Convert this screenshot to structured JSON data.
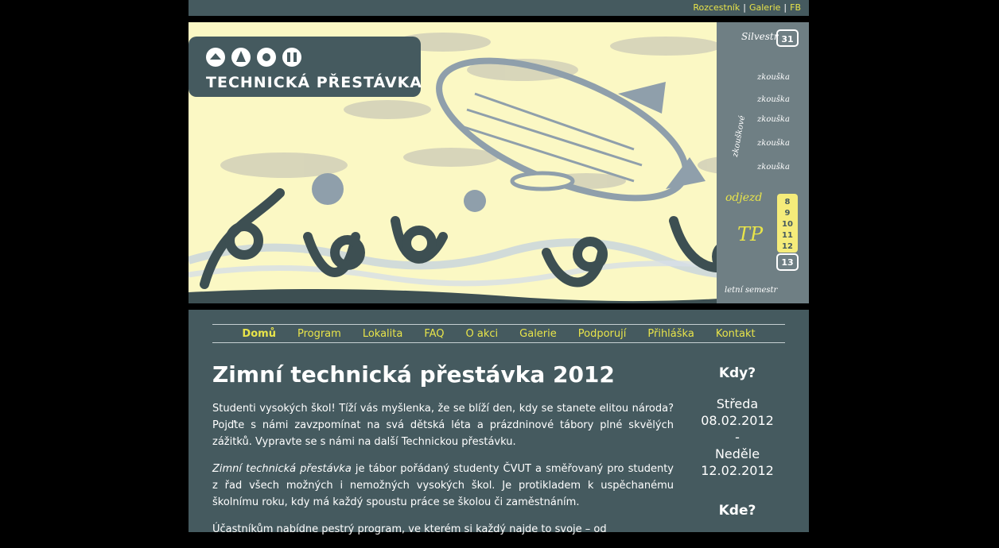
{
  "topbar": {
    "links": [
      "Rozcestník",
      "Galerie",
      "FB"
    ]
  },
  "banner": {
    "logo_text": "TECHNICKÁ PŘESTÁVKA",
    "calendar": {
      "silvestr": "Silvestr",
      "day_31": "31",
      "highlight_days": [
        "8",
        "9",
        "10",
        "11",
        "12"
      ],
      "day_13": "13",
      "zkouska_label": "zkouška",
      "zkouskove_label": "zkouškové",
      "odjezd_label": "odjezd",
      "tp_label": "TP",
      "letni_label": "letní semestr"
    }
  },
  "nav": {
    "items": [
      "Domů",
      "Program",
      "Lokalita",
      "FAQ",
      "O akci",
      "Galerie",
      "Podporují",
      "Přihláška",
      "Kontakt"
    ],
    "active": "Domů"
  },
  "main": {
    "title": "Zimní technická přestávka 2012",
    "p1": "Studenti vysokých škol! Tíží vás myšlenka, že se blíží den, kdy se stanete elitou národa? Pojďte s námi zavzpomínat na svá dětská léta a prázdninové tábory plné skvělých zážitků. Vypravte se s námi na další Technickou přestávku.",
    "p2_em": "Zimní technická přestávka",
    "p2_rest": " je tábor pořádaný studenty ČVUT a směřovaný pro studenty z řad všech možných i nemožných vysokých škol. Je protikladem k uspěchanému školnímu roku, kdy má každý spoustu práce se školou či zaměstnáním.",
    "p3": "Účastníkům nabídne pestrý program, ve kterém si každý najde to svoje – od"
  },
  "side": {
    "when_title": "Kdy?",
    "start_day": "Středa",
    "start_date": "08.02.2012",
    "dash": "-",
    "end_day": "Neděle",
    "end_date": "12.02.2012",
    "where_title": "Kde?"
  }
}
